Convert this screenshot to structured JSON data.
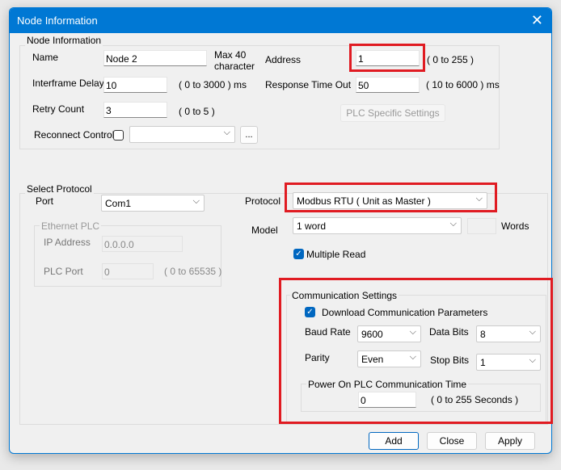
{
  "window": {
    "title": "Node Information",
    "close": "✕"
  },
  "node": {
    "legend": "Node Information",
    "name_label": "Name",
    "name_value": "Node 2",
    "name_hint1": "Max 40",
    "name_hint2": "character",
    "address_label": "Address",
    "address_value": "1",
    "address_range": "( 0 to 255 )",
    "interframe_label": "Interframe Delay",
    "interframe_value": "10",
    "interframe_range": "( 0 to 3000 ) ms",
    "response_label": "Response Time Out",
    "response_value": "50",
    "response_range": "( 10 to 6000 ) ms",
    "retry_label": "Retry Count",
    "retry_value": "3",
    "retry_range": "( 0 to 5 )",
    "plc_specific_button": "PLC Specific Settings",
    "reconnect_label": "Reconnect Control",
    "reconnect_value": "",
    "ellipsis_button": "..."
  },
  "protocol": {
    "legend": "Select Protocol",
    "port_label": "Port",
    "port_value": "Com1",
    "protocol_label": "Protocol",
    "protocol_value": "Modbus RTU ( Unit as Master )",
    "model_label": "Model",
    "model_value": "1 word",
    "words_value": "",
    "words_label": "Words",
    "multiple_read_label": "Multiple Read",
    "multiple_read_checked": true,
    "ethernet": {
      "legend": "Ethernet PLC",
      "ip_label": "IP Address",
      "ip_value": "0.0.0.0",
      "port_label": "PLC Port",
      "port_value": "0",
      "port_range": "( 0 to 65535 )"
    }
  },
  "comm": {
    "legend": "Communication Settings",
    "download_label": "Download Communication Parameters",
    "download_checked": true,
    "baud_label": "Baud Rate",
    "baud_value": "9600",
    "data_bits_label": "Data Bits",
    "data_bits_value": "8",
    "parity_label": "Parity",
    "parity_value": "Even",
    "stop_bits_label": "Stop Bits",
    "stop_bits_value": "1",
    "power_on_legend": "Power On PLC Communication Time",
    "power_on_value": "0",
    "power_on_range": "( 0 to 255 Seconds )"
  },
  "buttons": {
    "add": "Add",
    "close": "Close",
    "apply": "Apply"
  },
  "icons": {
    "chevron": "⌵",
    "check": "✓"
  }
}
